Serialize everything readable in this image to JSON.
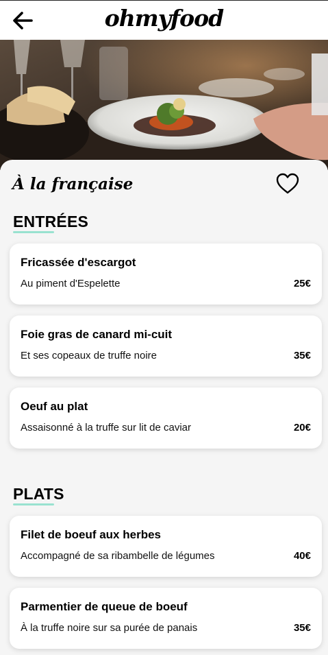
{
  "header": {
    "back_icon": "arrow-left-icon",
    "logo": "ohmyfood"
  },
  "hero": {
    "image": "plated-dish-restaurant-photo"
  },
  "restaurant": {
    "name": "À la française",
    "favorite_icon": "heart-outline-icon"
  },
  "sections": [
    {
      "title": "ENTRÉES",
      "items": [
        {
          "name": "Fricassée d'escargot",
          "desc": "Au piment d'Espelette",
          "price": "25€"
        },
        {
          "name": "Foie gras de canard mi-cuit",
          "desc": "Et ses copeaux de truffe noire",
          "price": "35€"
        },
        {
          "name": "Oeuf au plat",
          "desc": "Assaisonné à la truffe sur lit de caviar",
          "price": "20€"
        }
      ]
    },
    {
      "title": "PLATS",
      "items": [
        {
          "name": "Filet de boeuf aux herbes",
          "desc": "Accompagné de sa ribambelle de légumes",
          "price": "40€"
        },
        {
          "name": "Parmentier de queue de boeuf",
          "desc": "À la truffe noire sur sa purée de panais",
          "price": "35€"
        }
      ]
    }
  ],
  "colors": {
    "accent_underline": "#99e2d0",
    "background": "#f5f5f5",
    "card": "#ffffff"
  }
}
